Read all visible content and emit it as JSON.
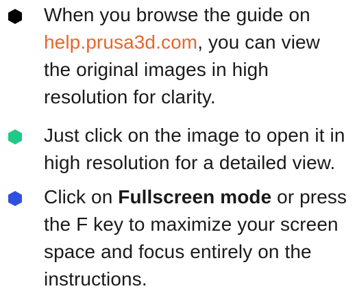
{
  "colors": {
    "bullet_1": "#000000",
    "bullet_2": "#20c986",
    "bullet_3": "#2f4fe0",
    "link": "#e8662b",
    "text": "#1a1a1a"
  },
  "items": [
    {
      "bullet_icon": "hexagon-icon",
      "text_before": "When you browse the guide on ",
      "link_text": "help.prusa3d.com",
      "text_after": ", you can view the original images in high resolution for clarity."
    },
    {
      "bullet_icon": "hexagon-icon",
      "text": "Just click on the image to open it in high resolution for a detailed view."
    },
    {
      "bullet_icon": "hexagon-icon",
      "text_before": "Click on ",
      "bold_text": "Fullscreen mode",
      "text_after": " or press the F key to maximize your screen space and focus entirely on the instructions."
    }
  ]
}
